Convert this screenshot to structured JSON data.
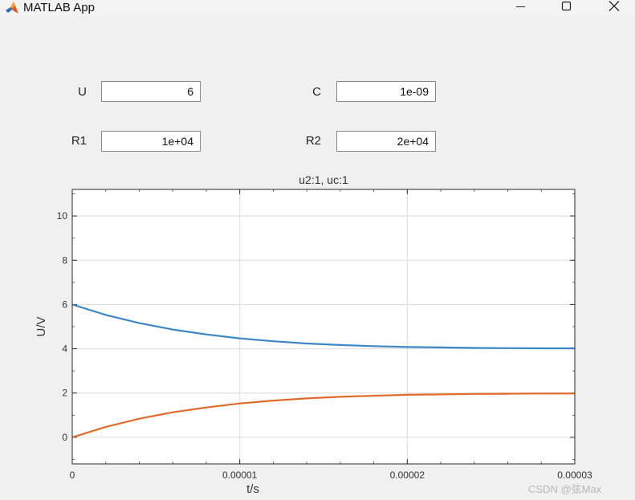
{
  "window": {
    "title": "MATLAB App",
    "icon": "matlab-logo-icon",
    "controls": [
      "minimize-icon",
      "maximize-icon",
      "close-icon"
    ]
  },
  "params": {
    "U": {
      "label": "U",
      "value": "6"
    },
    "C": {
      "label": "C",
      "value": "1e-09"
    },
    "R1": {
      "label": "R1",
      "value": "1e+04"
    },
    "R2": {
      "label": "R2",
      "value": "2e+04"
    }
  },
  "chart_data": {
    "type": "line",
    "title": "u2:1, uc:1",
    "xlabel": "t/s",
    "ylabel": "U/V",
    "xlim": [
      0,
      3e-05
    ],
    "ylim": [
      -1.2,
      11.2
    ],
    "xticks": [
      0,
      1e-05,
      2e-05,
      3e-05
    ],
    "xticklabels": [
      "0",
      "0.00001",
      "0.00002",
      "0.00003"
    ],
    "yticks": [
      0,
      2,
      4,
      6,
      8,
      10
    ],
    "yticklabels": [
      "0",
      "2",
      "4",
      "6",
      "8",
      "10"
    ],
    "grid": true,
    "series": [
      {
        "color": "#3c87c6",
        "x": [
          0,
          2e-06,
          4e-06,
          6e-06,
          8e-06,
          1e-05,
          1.2e-05,
          1.4e-05,
          1.6e-05,
          1.8e-05,
          2e-05,
          2.2e-05,
          2.4e-05,
          2.6e-05,
          2.8e-05,
          3e-05
        ],
        "y": [
          6,
          5.53,
          5.16,
          4.87,
          4.65,
          4.47,
          4.34,
          4.24,
          4.17,
          4.12,
          4.08,
          4.06,
          4.04,
          4.03,
          4.02,
          4.02
        ]
      },
      {
        "color": "#e06b2a",
        "x": [
          0,
          2e-06,
          4e-06,
          6e-06,
          8e-06,
          1e-05,
          1.2e-05,
          1.4e-05,
          1.6e-05,
          1.8e-05,
          2e-05,
          2.2e-05,
          2.4e-05,
          2.6e-05,
          2.8e-05,
          3e-05
        ],
        "y": [
          0,
          0.47,
          0.84,
          1.13,
          1.35,
          1.53,
          1.66,
          1.76,
          1.83,
          1.88,
          1.92,
          1.94,
          1.96,
          1.97,
          1.98,
          1.98
        ]
      }
    ]
  },
  "watermark": "CSDN @弦Max"
}
